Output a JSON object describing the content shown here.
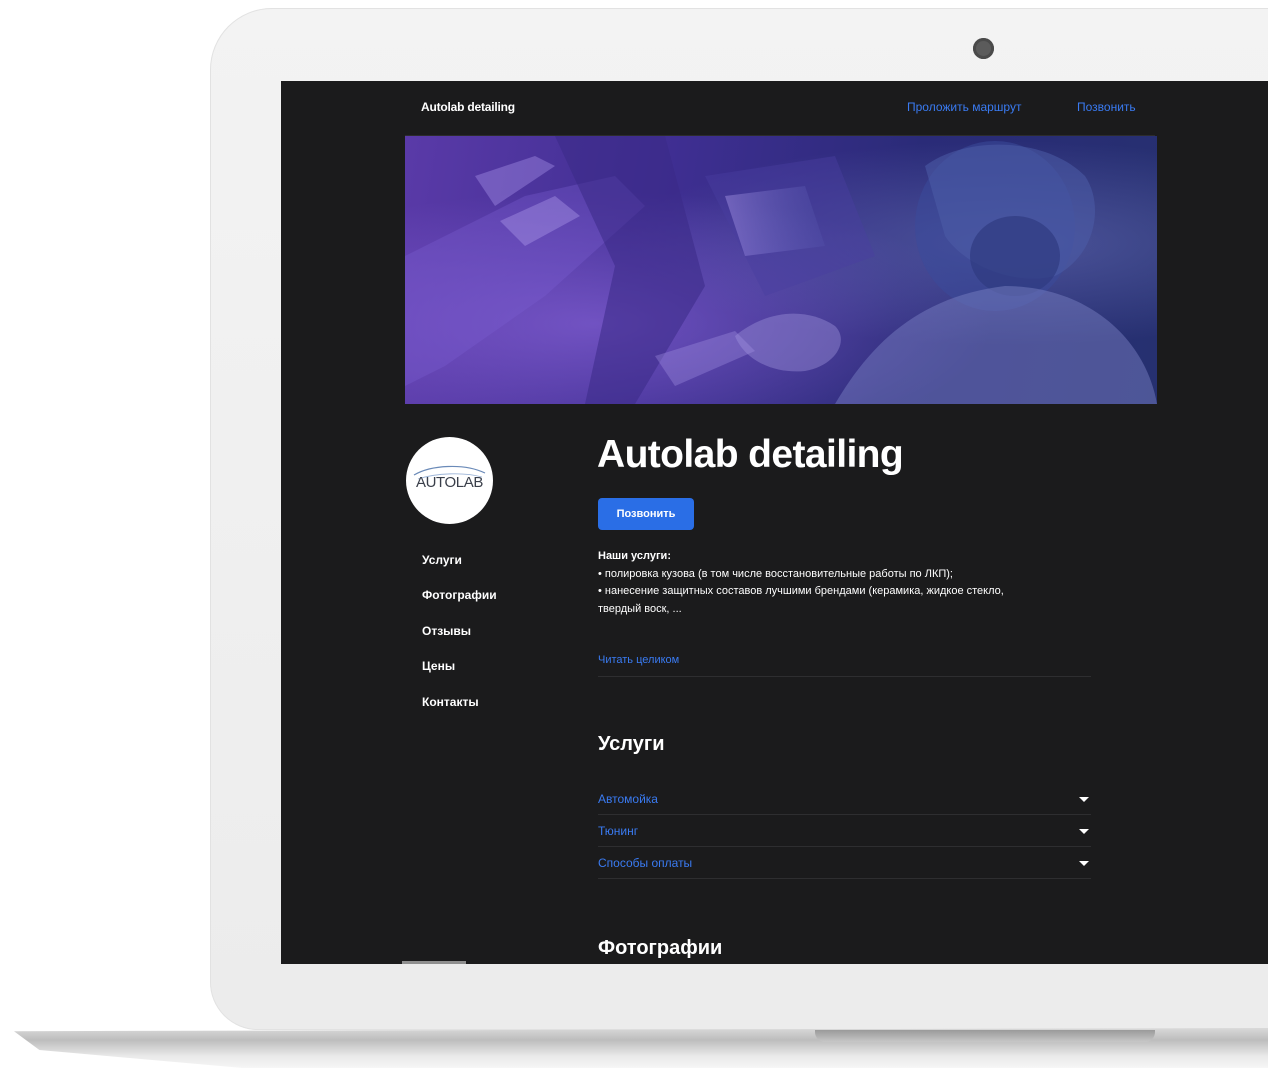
{
  "header": {
    "brand": "Autolab detailing",
    "links": [
      {
        "label": "Проложить маршрут"
      },
      {
        "label": "Позвонить"
      }
    ]
  },
  "logo": {
    "text": "AUTOLAB"
  },
  "sidebar": {
    "items": [
      {
        "label": "Услуги"
      },
      {
        "label": "Фотографии"
      },
      {
        "label": "Отзывы"
      },
      {
        "label": "Цены"
      },
      {
        "label": "Контакты"
      }
    ]
  },
  "main": {
    "title": "Autolab detailing",
    "call_button": "Позвонить",
    "description": [
      "Наши услуги:",
      "• полировка кузова (в том числе восстановительные работы по ЛКП);",
      "• нанесение защитных составов лучшими брендами (керамика, жидкое стекло,",
      "твердый воск, ..."
    ],
    "read_more": "Читать целиком",
    "services_heading": "Услуги",
    "services": [
      {
        "label": "Автомойка"
      },
      {
        "label": "Тюнинг"
      },
      {
        "label": "Способы оплаты"
      }
    ],
    "photos_heading": "Фотографии"
  },
  "colors": {
    "background": "#1b1b1c",
    "accent": "#3a7bf2",
    "button": "#2a6ee6",
    "hero_gradient_start": "#5a3aa8",
    "hero_gradient_end": "#263070"
  },
  "icons": {
    "accordion_caret": "caret-down-icon",
    "camera": "camera-dot"
  }
}
